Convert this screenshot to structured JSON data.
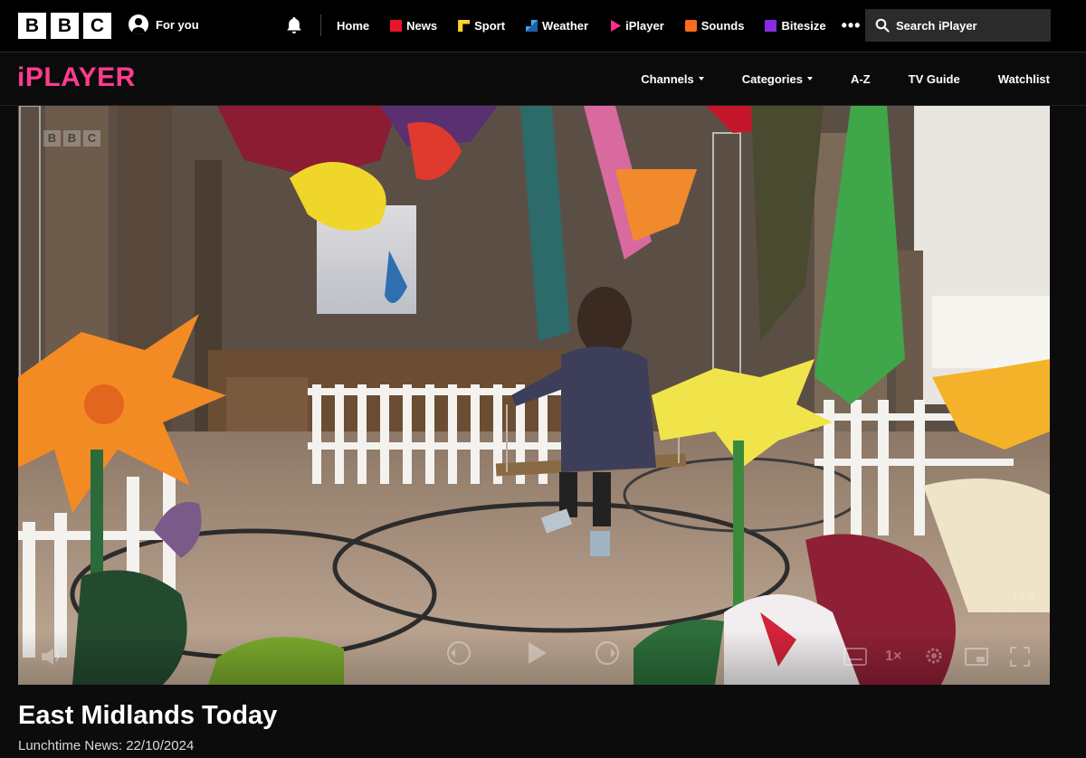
{
  "global_nav": {
    "logo_letters": [
      "B",
      "B",
      "C"
    ],
    "for_you": "For you",
    "links": [
      {
        "label": "Home",
        "icon": "none"
      },
      {
        "label": "News",
        "icon": "news-icon"
      },
      {
        "label": "Sport",
        "icon": "sport-icon"
      },
      {
        "label": "Weather",
        "icon": "weather-icon"
      },
      {
        "label": "iPlayer",
        "icon": "iplayer-icon"
      },
      {
        "label": "Sounds",
        "icon": "sounds-icon"
      },
      {
        "label": "Bitesize",
        "icon": "bitesize-icon"
      }
    ],
    "more": "•••",
    "search_placeholder": "Search iPlayer"
  },
  "iplayer_nav": {
    "logo": "iPLAYER",
    "items": [
      {
        "label": "Channels",
        "dropdown": true
      },
      {
        "label": "Categories",
        "dropdown": true
      },
      {
        "label": "A-Z",
        "dropdown": false
      },
      {
        "label": "TV Guide",
        "dropdown": false
      },
      {
        "label": "Watchlist",
        "dropdown": false
      }
    ]
  },
  "player": {
    "watermark": [
      "B",
      "B",
      "C"
    ],
    "speed": "1×",
    "time_remaining": "10:0",
    "scene": "cathedral nave with giant paper flowers and a woman on a swing"
  },
  "programme": {
    "title": "East Midlands Today",
    "episode": "Lunchtime News: 22/10/2024"
  },
  "colors": {
    "iplayer_pink": "#ff3b8d",
    "background": "#0c0c0c"
  }
}
